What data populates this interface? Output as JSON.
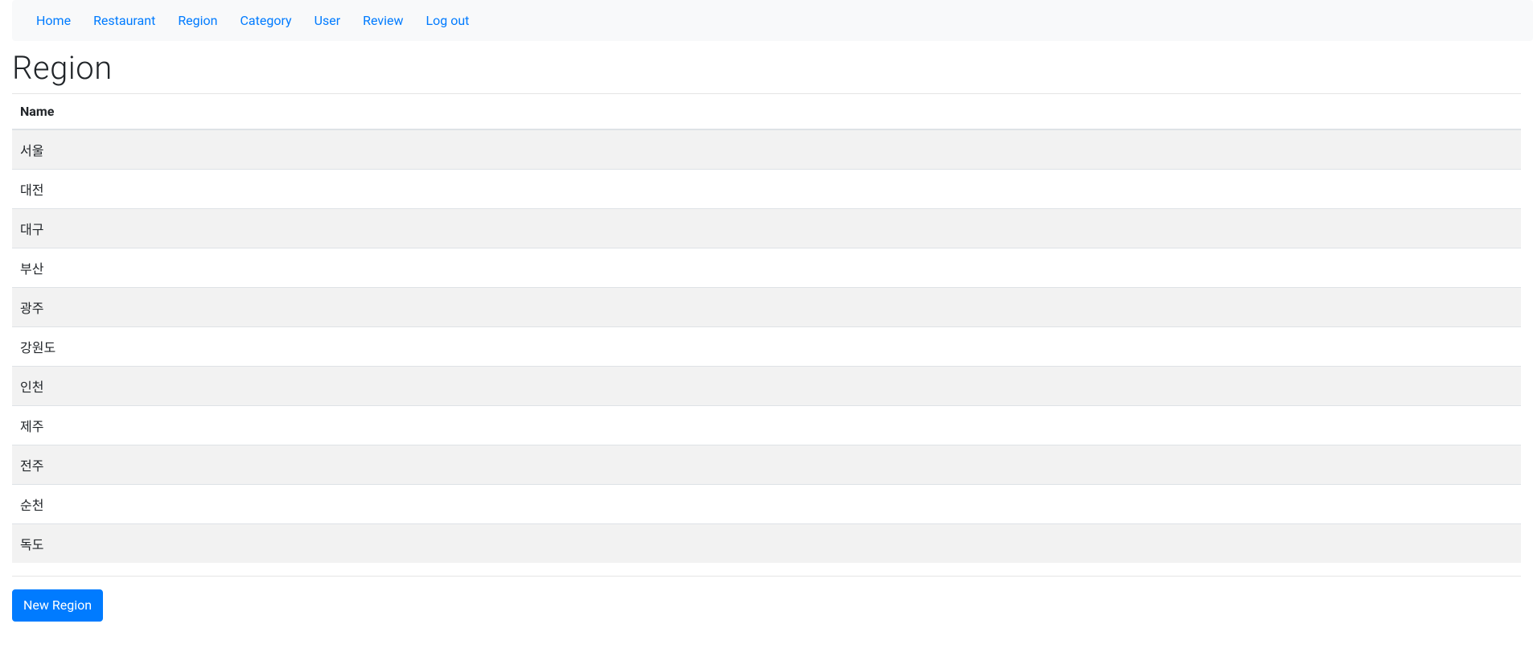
{
  "nav": {
    "items": [
      {
        "label": "Home"
      },
      {
        "label": "Restaurant"
      },
      {
        "label": "Region"
      },
      {
        "label": "Category"
      },
      {
        "label": "User"
      },
      {
        "label": "Review"
      },
      {
        "label": "Log out"
      }
    ]
  },
  "page": {
    "title": "Region"
  },
  "table": {
    "columns": [
      {
        "header": "Name"
      }
    ],
    "rows": [
      {
        "name": "서울"
      },
      {
        "name": "대전"
      },
      {
        "name": "대구"
      },
      {
        "name": "부산"
      },
      {
        "name": "광주"
      },
      {
        "name": "강원도"
      },
      {
        "name": "인천"
      },
      {
        "name": "제주"
      },
      {
        "name": "전주"
      },
      {
        "name": "순천"
      },
      {
        "name": "독도"
      }
    ]
  },
  "actions": {
    "new_region_label": "New Region"
  }
}
